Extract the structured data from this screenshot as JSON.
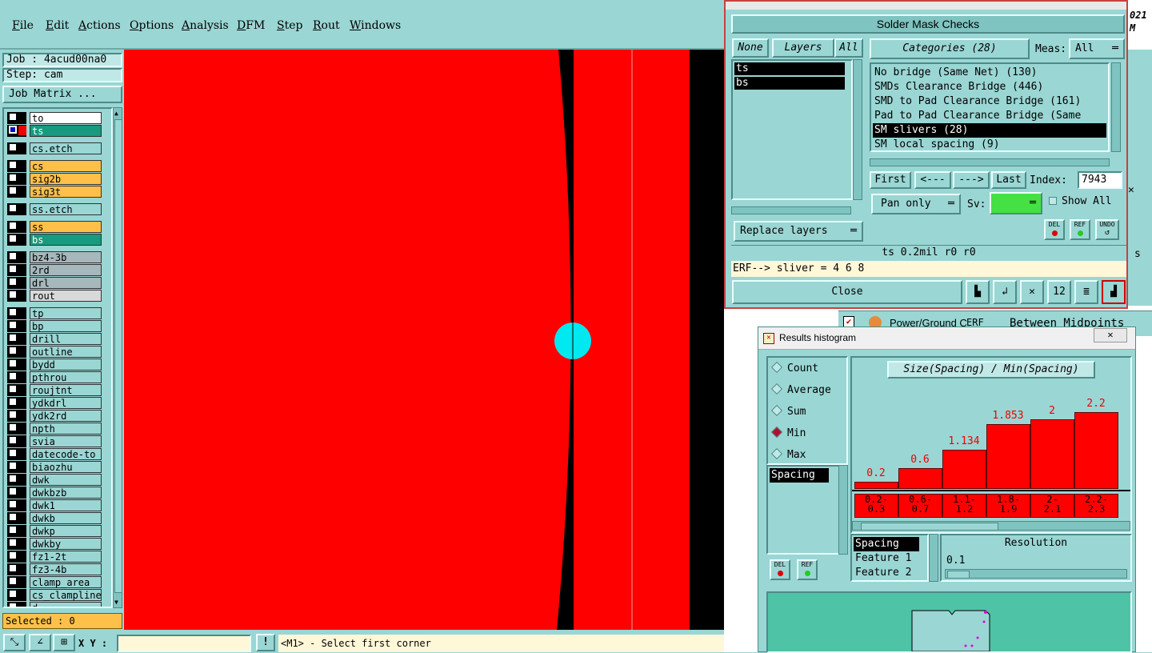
{
  "menubar": {
    "items": [
      "File",
      "Edit",
      "Actions",
      "Options",
      "Analysis",
      "DFM",
      "Step",
      "Rout",
      "Windows"
    ]
  },
  "left_panel": {
    "job": "Job : 4acud00na0",
    "step": "Step: cam",
    "job_matrix_button": "Job Matrix ...",
    "layers": [
      {
        "name": "to",
        "color": "#ffffff"
      },
      {
        "name": "ts",
        "color": "#179a7e"
      },
      {
        "name": "cs.etch",
        "color": "#9ad6d4"
      },
      {
        "name": "cs",
        "color": "#ffc04a"
      },
      {
        "name": "sig2b",
        "color": "#ffc04a"
      },
      {
        "name": "sig3t",
        "color": "#ffc04a"
      },
      {
        "name": "ss.etch",
        "color": "#9ad6d4"
      },
      {
        "name": "ss",
        "color": "#ffc04a"
      },
      {
        "name": "bs",
        "color": "#179a7e"
      },
      {
        "name": "bz4-3b",
        "color": "#a6b8bb"
      },
      {
        "name": "2rd",
        "color": "#a6b8bb"
      },
      {
        "name": "drl",
        "color": "#a6b8bb"
      },
      {
        "name": "rout",
        "color": "#d9d9d9"
      },
      {
        "name": "tp",
        "color": "#9ad6d4"
      },
      {
        "name": "bp",
        "color": "#9ad6d4"
      },
      {
        "name": "drill",
        "color": "#9ad6d4"
      },
      {
        "name": "outline",
        "color": "#9ad6d4"
      },
      {
        "name": "bydd",
        "color": "#9ad6d4"
      },
      {
        "name": "pthrou",
        "color": "#9ad6d4"
      },
      {
        "name": "roujtnt",
        "color": "#9ad6d4"
      },
      {
        "name": "ydkdrl",
        "color": "#9ad6d4"
      },
      {
        "name": "ydk2rd",
        "color": "#9ad6d4"
      },
      {
        "name": "npth",
        "color": "#9ad6d4"
      },
      {
        "name": "svia",
        "color": "#9ad6d4"
      },
      {
        "name": "datecode-to",
        "color": "#9ad6d4"
      },
      {
        "name": "biaozhu",
        "color": "#9ad6d4"
      },
      {
        "name": "dwk",
        "color": "#9ad6d4"
      },
      {
        "name": "dwkbzb",
        "color": "#9ad6d4"
      },
      {
        "name": "dwk1",
        "color": "#9ad6d4"
      },
      {
        "name": "dwkb",
        "color": "#9ad6d4"
      },
      {
        "name": "dwkp",
        "color": "#9ad6d4"
      },
      {
        "name": "dwkby",
        "color": "#9ad6d4"
      },
      {
        "name": "fz1-2t",
        "color": "#9ad6d4"
      },
      {
        "name": "fz3-4b",
        "color": "#9ad6d4"
      },
      {
        "name": "clamp_area",
        "color": "#9ad6d4"
      },
      {
        "name": "cs_clampline",
        "color": "#9ad6d4"
      },
      {
        "name": "d",
        "color": "#9ad6d4"
      }
    ],
    "selected": "Selected : 0"
  },
  "statusbar": {
    "xy_label": "X Y :",
    "xy_value": "",
    "prompt": "<M1> - Select first corner"
  },
  "results_viewer": {
    "title": "Solder Mask Checks",
    "none_btn": "None",
    "layers_btn": "Layers",
    "all_btn": "All",
    "layer_items": [
      "ts",
      "bs"
    ],
    "categories_btn": "Categories (28)",
    "meas_label": "Meas:",
    "meas_value": "All",
    "categories": [
      "No bridge (Same Net) (130)",
      "SMDs Clearance Bridge (446)",
      "SMD to Pad Clearance Bridge (161)",
      "Pad to Pad Clearance Bridge (Same",
      "SM slivers (28)",
      "SM local spacing (9)"
    ],
    "first_btn": "First",
    "prev_btn": "<---",
    "next_btn": "--->",
    "last_btn": "Last",
    "index_label": "Index:",
    "index_value": "7943",
    "pan_value": "Pan only",
    "sv_label": "Sv:",
    "show_all": "Show All",
    "replace_layers": "Replace layers",
    "del": "DEL",
    "ref": "REF",
    "undo": "UNDO",
    "info": "ts 0.2mil  r0  r0",
    "erf": "ERF--> sliver = 4 6 8",
    "close": "Close",
    "bg_label_power": "Power/Ground C",
    "bg_label_erf": "ERF",
    "bg_label_mid": "Between Midpoints",
    "bg_date": "021",
    "bg_m": "M"
  },
  "histogram": {
    "title": "Results histogram",
    "radios": [
      {
        "label": "Count",
        "on": false
      },
      {
        "label": "Average",
        "on": false
      },
      {
        "label": "Sum",
        "on": false
      },
      {
        "label": "Min",
        "on": true
      },
      {
        "label": "Max",
        "on": false
      }
    ],
    "list_item": "Spacing",
    "del": "DEL",
    "ref": "REF",
    "chart_header": "Size(Spacing) / Min(Spacing)",
    "feature_list": [
      "Spacing",
      "Feature 1",
      "Feature 2"
    ],
    "resolution_label": "Resolution",
    "resolution_value": "0.1"
  },
  "chart_data": {
    "type": "bar",
    "title": "Size(Spacing) / Min(Spacing)",
    "categories": [
      "0.2-\n0.3",
      "0.6-\n0.7",
      "1.1-\n1.2",
      "1.8-\n1.9",
      "2-\n2.1",
      "2.2-\n2.3"
    ],
    "values": [
      0.2,
      0.6,
      1.134,
      1.853,
      2,
      2.2
    ],
    "value_labels": [
      "0.2",
      "0.6",
      "1.134",
      "1.853",
      "2",
      "2.2"
    ],
    "ylim": [
      0,
      2.2
    ],
    "bar_color": "#ff0000"
  }
}
